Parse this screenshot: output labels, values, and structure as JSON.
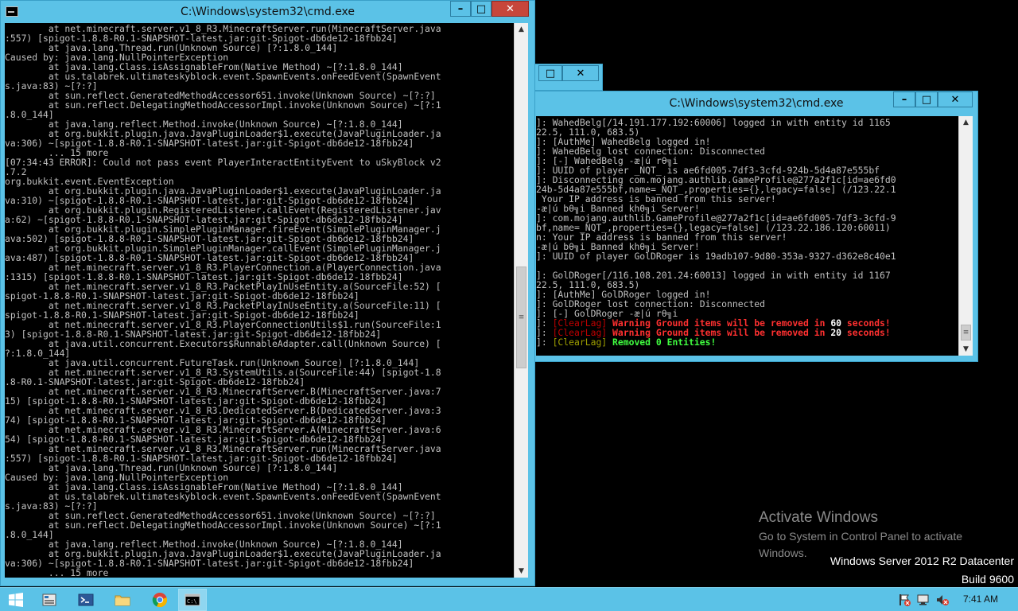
{
  "main_window": {
    "title": "C:\\Windows\\system32\\cmd.exe",
    "minimize_label": "–",
    "maximize_label": "□",
    "close_label": "✕",
    "scroll_up": "▲",
    "scroll_down": "▼",
    "scroll_grip": "≡",
    "lines": [
      "        at net.minecraft.server.v1_8_R3.MinecraftServer.run(MinecraftServer.java",
      ":557) [spigot-1.8.8-R0.1-SNAPSHOT-latest.jar:git-Spigot-db6de12-18fbb24]",
      "        at java.lang.Thread.run(Unknown Source) [?:1.8.0_144]",
      "Caused by: java.lang.NullPointerException",
      "        at java.lang.Class.isAssignableFrom(Native Method) ~[?:1.8.0_144]",
      "        at us.talabrek.ultimateskyblock.event.SpawnEvents.onFeedEvent(SpawnEvent",
      "s.java:83) ~[?:?]",
      "        at sun.reflect.GeneratedMethodAccessor651.invoke(Unknown Source) ~[?:?]",
      "        at sun.reflect.DelegatingMethodAccessorImpl.invoke(Unknown Source) ~[?:1",
      ".8.0_144]",
      "        at java.lang.reflect.Method.invoke(Unknown Source) ~[?:1.8.0_144]",
      "        at org.bukkit.plugin.java.JavaPluginLoader$1.execute(JavaPluginLoader.ja",
      "va:306) ~[spigot-1.8.8-R0.1-SNAPSHOT-latest.jar:git-Spigot-db6de12-18fbb24]",
      "        ... 15 more",
      "[07:34:43 ERROR]: Could not pass event PlayerInteractEntityEvent to uSkyBlock v2",
      ".7.2",
      "org.bukkit.event.EventException",
      "        at org.bukkit.plugin.java.JavaPluginLoader$1.execute(JavaPluginLoader.ja",
      "va:310) ~[spigot-1.8.8-R0.1-SNAPSHOT-latest.jar:git-Spigot-db6de12-18fbb24]",
      "        at org.bukkit.plugin.RegisteredListener.callEvent(RegisteredListener.jav",
      "a:62) ~[spigot-1.8.8-R0.1-SNAPSHOT-latest.jar:git-Spigot-db6de12-18fbb24]",
      "        at org.bukkit.plugin.SimplePluginManager.fireEvent(SimplePluginManager.j",
      "ava:502) [spigot-1.8.8-R0.1-SNAPSHOT-latest.jar:git-Spigot-db6de12-18fbb24]",
      "        at org.bukkit.plugin.SimplePluginManager.callEvent(SimplePluginManager.j",
      "ava:487) [spigot-1.8.8-R0.1-SNAPSHOT-latest.jar:git-Spigot-db6de12-18fbb24]",
      "        at net.minecraft.server.v1_8_R3.PlayerConnection.a(PlayerConnection.java",
      ":1315) [spigot-1.8.8-R0.1-SNAPSHOT-latest.jar:git-Spigot-db6de12-18fbb24]",
      "        at net.minecraft.server.v1_8_R3.PacketPlayInUseEntity.a(SourceFile:52) [",
      "spigot-1.8.8-R0.1-SNAPSHOT-latest.jar:git-Spigot-db6de12-18fbb24]",
      "        at net.minecraft.server.v1_8_R3.PacketPlayInUseEntity.a(SourceFile:11) [",
      "spigot-1.8.8-R0.1-SNAPSHOT-latest.jar:git-Spigot-db6de12-18fbb24]",
      "        at net.minecraft.server.v1_8_R3.PlayerConnectionUtils$1.run(SourceFile:1",
      "3) [spigot-1.8.8-R0.1-SNAPSHOT-latest.jar:git-Spigot-db6de12-18fbb24]",
      "        at java.util.concurrent.Executors$RunnableAdapter.call(Unknown Source) [",
      "?:1.8.0_144]",
      "        at java.util.concurrent.FutureTask.run(Unknown Source) [?:1.8.0_144]",
      "        at net.minecraft.server.v1_8_R3.SystemUtils.a(SourceFile:44) [spigot-1.8",
      ".8-R0.1-SNAPSHOT-latest.jar:git-Spigot-db6de12-18fbb24]",
      "        at net.minecraft.server.v1_8_R3.MinecraftServer.B(MinecraftServer.java:7",
      "15) [spigot-1.8.8-R0.1-SNAPSHOT-latest.jar:git-Spigot-db6de12-18fbb24]",
      "        at net.minecraft.server.v1_8_R3.DedicatedServer.B(DedicatedServer.java:3",
      "74) [spigot-1.8.8-R0.1-SNAPSHOT-latest.jar:git-Spigot-db6de12-18fbb24]",
      "        at net.minecraft.server.v1_8_R3.MinecraftServer.A(MinecraftServer.java:6",
      "54) [spigot-1.8.8-R0.1-SNAPSHOT-latest.jar:git-Spigot-db6de12-18fbb24]",
      "        at net.minecraft.server.v1_8_R3.MinecraftServer.run(MinecraftServer.java",
      ":557) [spigot-1.8.8-R0.1-SNAPSHOT-latest.jar:git-Spigot-db6de12-18fbb24]",
      "        at java.lang.Thread.run(Unknown Source) [?:1.8.0_144]",
      "Caused by: java.lang.NullPointerException",
      "        at java.lang.Class.isAssignableFrom(Native Method) ~[?:1.8.0_144]",
      "        at us.talabrek.ultimateskyblock.event.SpawnEvents.onFeedEvent(SpawnEvent",
      "s.java:83) ~[?:?]",
      "        at sun.reflect.GeneratedMethodAccessor651.invoke(Unknown Source) ~[?:?]",
      "        at sun.reflect.DelegatingMethodAccessorImpl.invoke(Unknown Source) ~[?:1",
      ".8.0_144]",
      "        at java.lang.reflect.Method.invoke(Unknown Source) ~[?:1.8.0_144]",
      "        at org.bukkit.plugin.java.JavaPluginLoader$1.execute(JavaPluginLoader.ja",
      "va:306) ~[spigot-1.8.8-R0.1-SNAPSHOT-latest.jar:git-Spigot-db6de12-18fbb24]",
      "        ... 15 more"
    ]
  },
  "back_window": {
    "maximize_label": "□",
    "close_label": "✕"
  },
  "second_window": {
    "title": "C:\\Windows\\system32\\cmd.exe",
    "minimize_label": "–",
    "maximize_label": "□",
    "close_label": "✕",
    "scroll_up": "▲",
    "scroll_down": "▼",
    "scroll_grip": "≡",
    "lines": [
      [
        {
          "t": "]: WahedBelg[/14.191.177.192:60006] logged in with entity id 1165"
        }
      ],
      [
        {
          "t": "22.5, 111.0, 683.5)"
        }
      ],
      [
        {
          "t": "]: [AuthMe] WahedBelg logged in!"
        }
      ],
      [
        {
          "t": "]: WahedBelg lost connection: Disconnected"
        }
      ],
      [
        {
          "t": "]: [-] WahedBelg -æ|ú rθ╗i"
        }
      ],
      [
        {
          "t": "]: UUID of player _NQT_ is ae6fd005-7df3-3cfd-924b-5d4a87e555bf"
        }
      ],
      [
        {
          "t": "]: Disconnecting com.mojang.authlib.GameProfile@277a2f1c[id=ae6fd0"
        }
      ],
      [
        {
          "t": "24b-5d4a87e555bf,name=_NQT_,properties={},legacy=false] (/123.22.1"
        }
      ],
      [
        {
          "t": " Your IP address is banned from this server!"
        }
      ],
      [
        {
          "t": "-æ|ú bθ╗i Banned khθ╗i Server!"
        }
      ],
      [
        {
          "t": "]: com.mojang.authlib.GameProfile@277a2f1c[id=ae6fd005-7df3-3cfd-9"
        }
      ],
      [
        {
          "t": "bf,name=_NQT_,properties={},legacy=false] (/123.22.186.120:60011)"
        }
      ],
      [
        {
          "t": "n: Your IP address is banned from this server!"
        }
      ],
      [
        {
          "t": "-æ|ú bθ╗i Banned khθ╗i Server!"
        }
      ],
      [
        {
          "t": "]: UUID of player GolDRoger is 19adb107-9d80-353a-9327-d362e8c40e1"
        }
      ],
      [
        {
          "t": ""
        }
      ],
      [
        {
          "t": "]: GolDRoger[/116.108.201.24:60013] logged in with entity id 1167"
        }
      ],
      [
        {
          "t": "22.5, 111.0, 683.5)"
        }
      ],
      [
        {
          "t": "]: [AuthMe] GolDRoger logged in!"
        }
      ],
      [
        {
          "t": "]: GolDRoger lost connection: Disconnected"
        }
      ],
      [
        {
          "t": "]: [-] GolDRoger -æ|ú rθ╗i"
        }
      ],
      [
        {
          "t": "]: "
        },
        {
          "t": "[ClearLag] ",
          "c": "dkred"
        },
        {
          "t": "Warning Ground items will be removed in ",
          "c": "red"
        },
        {
          "t": "60",
          "c": "white"
        },
        {
          "t": " seconds!",
          "c": "red"
        }
      ],
      [
        {
          "t": "]: "
        },
        {
          "t": "[ClearLag] ",
          "c": "dkred"
        },
        {
          "t": "Warning Ground items will be removed in ",
          "c": "red"
        },
        {
          "t": "20",
          "c": "white"
        },
        {
          "t": " seconds!",
          "c": "red"
        }
      ],
      [
        {
          "t": "]: "
        },
        {
          "t": "[ClearLag] ",
          "c": "olive"
        },
        {
          "t": "Removed 0 Entities!",
          "c": "green"
        }
      ]
    ]
  },
  "watermark": {
    "title": "Activate Windows",
    "subtitle": "Go to System in Control Panel to activate Windows."
  },
  "edition": {
    "name": "Windows Server 2012 R2 Datacenter",
    "build": "Build 9600"
  },
  "taskbar": {
    "clock": "7:41 AM",
    "items": [
      "start",
      "server-manager",
      "powershell",
      "file-explorer",
      "chrome",
      "command-prompt"
    ]
  }
}
